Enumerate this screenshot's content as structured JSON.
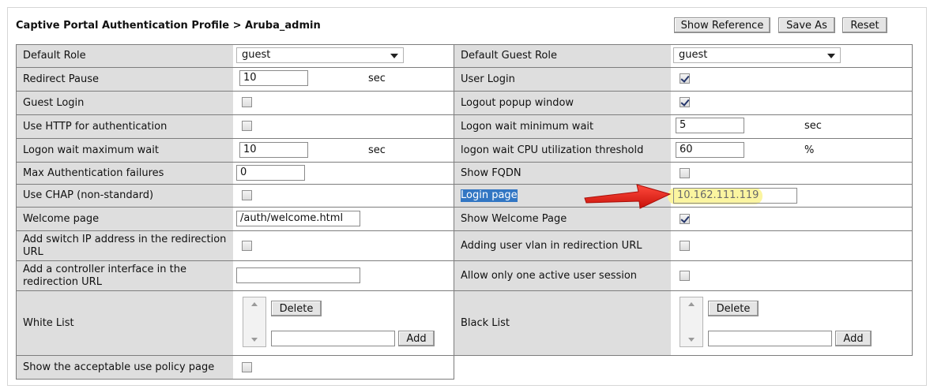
{
  "title": "Captive Portal Authentication Profile > Aruba_admin",
  "buttons": {
    "show_reference": "Show Reference",
    "save_as": "Save As",
    "reset": "Reset"
  },
  "left": {
    "default_role": {
      "label": "Default Role",
      "value": "guest"
    },
    "redirect_pause": {
      "label": "Redirect Pause",
      "value": "10",
      "unit": "sec"
    },
    "guest_login": {
      "label": "Guest Login",
      "checked": false
    },
    "use_http": {
      "label": "Use HTTP for authentication",
      "checked": false
    },
    "logon_wait_max": {
      "label": "Logon wait maximum wait",
      "value": "10",
      "unit": "sec"
    },
    "max_auth_failures": {
      "label": "Max Authentication failures",
      "value": "0"
    },
    "use_chap": {
      "label": "Use CHAP (non-standard)",
      "checked": false
    },
    "welcome_page": {
      "label": "Welcome page",
      "value": "/auth/welcome.html"
    },
    "add_switch_ip": {
      "label": "Add switch IP address in the redirection URL",
      "checked": false
    },
    "add_controller_if": {
      "label": "Add a controller interface in the redirection URL",
      "value": ""
    },
    "white_list": {
      "label": "White List",
      "delete": "Delete",
      "add": "Add",
      "value": ""
    },
    "show_aup": {
      "label": "Show the acceptable use policy page",
      "checked": false
    }
  },
  "right": {
    "default_guest_role": {
      "label": "Default Guest Role",
      "value": "guest"
    },
    "user_login": {
      "label": "User Login",
      "checked": true
    },
    "logout_popup": {
      "label": "Logout popup window",
      "checked": true
    },
    "logon_wait_min": {
      "label": "Logon wait minimum wait",
      "value": "5",
      "unit": "sec"
    },
    "logon_wait_cpu": {
      "label": "logon wait CPU utilization threshold",
      "value": "60",
      "unit": "%"
    },
    "show_fqdn": {
      "label": "Show FQDN",
      "checked": false
    },
    "login_page": {
      "label": "Login page",
      "value": "10.162.111.119"
    },
    "show_welcome": {
      "label": "Show Welcome Page",
      "checked": true
    },
    "adding_user_vlan": {
      "label": "Adding user vlan in redirection URL",
      "checked": false
    },
    "allow_one_session": {
      "label": "Allow only one active user session",
      "checked": false
    },
    "black_list": {
      "label": "Black List",
      "delete": "Delete",
      "add": "Add",
      "value": ""
    }
  },
  "colors": {
    "label_bg": "#dedede",
    "selection": "#3276c3",
    "highlight": "#fbf5a0",
    "arrow": "#e2231a"
  }
}
